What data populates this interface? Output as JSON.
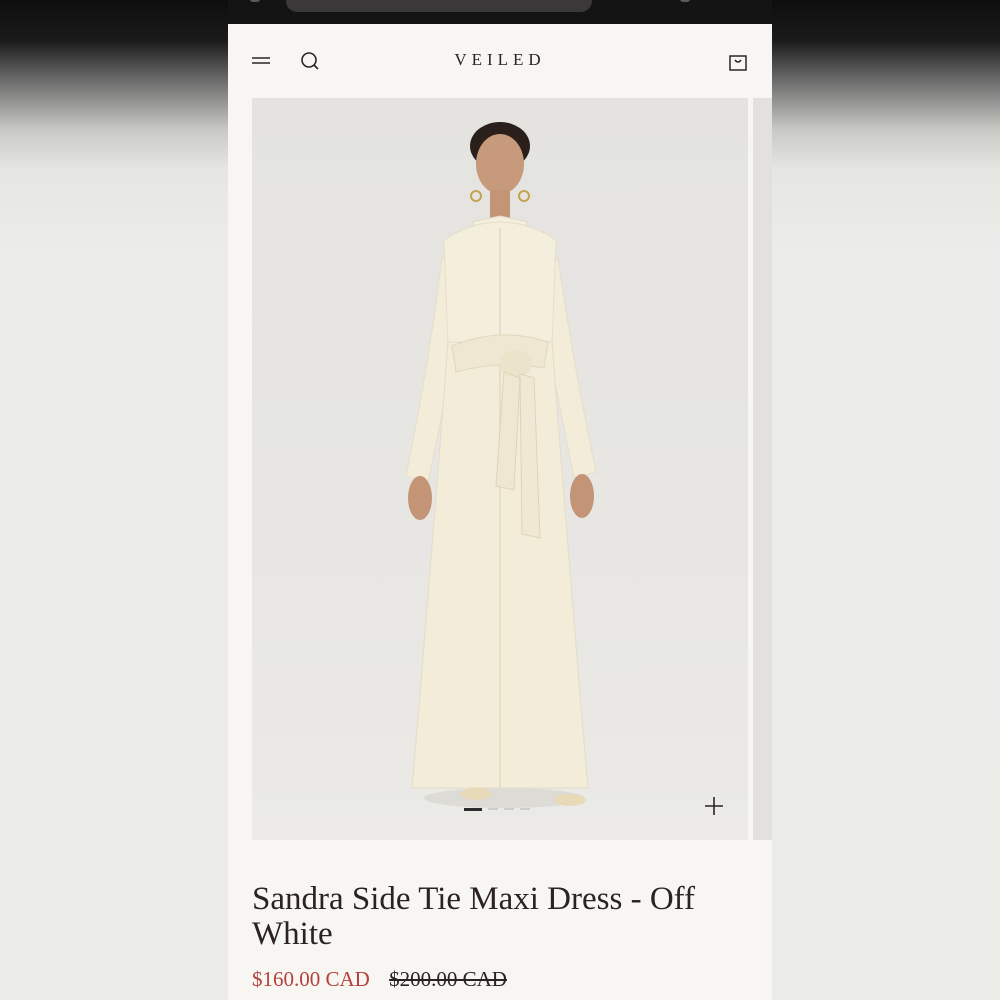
{
  "store": {
    "logo_text": "VEILED"
  },
  "header": {
    "menu_icon": "hamburger-menu-icon",
    "search_icon": "search-icon",
    "cart_icon": "shopping-bag-icon"
  },
  "gallery": {
    "image_description_icon": "product-photo",
    "slide_count": 4,
    "active_slide": 1,
    "zoom_icon": "plus-icon"
  },
  "product": {
    "title": "Sandra Side Tie Maxi Dress - Off White",
    "sale_price": "$160.00 CAD",
    "compare_price": "$200.00 CAD"
  },
  "colors": {
    "sale_price": "#b5413c",
    "text": "#2b2222",
    "page_bg": "#f7f6f2",
    "dress": "#f3ecd9"
  }
}
